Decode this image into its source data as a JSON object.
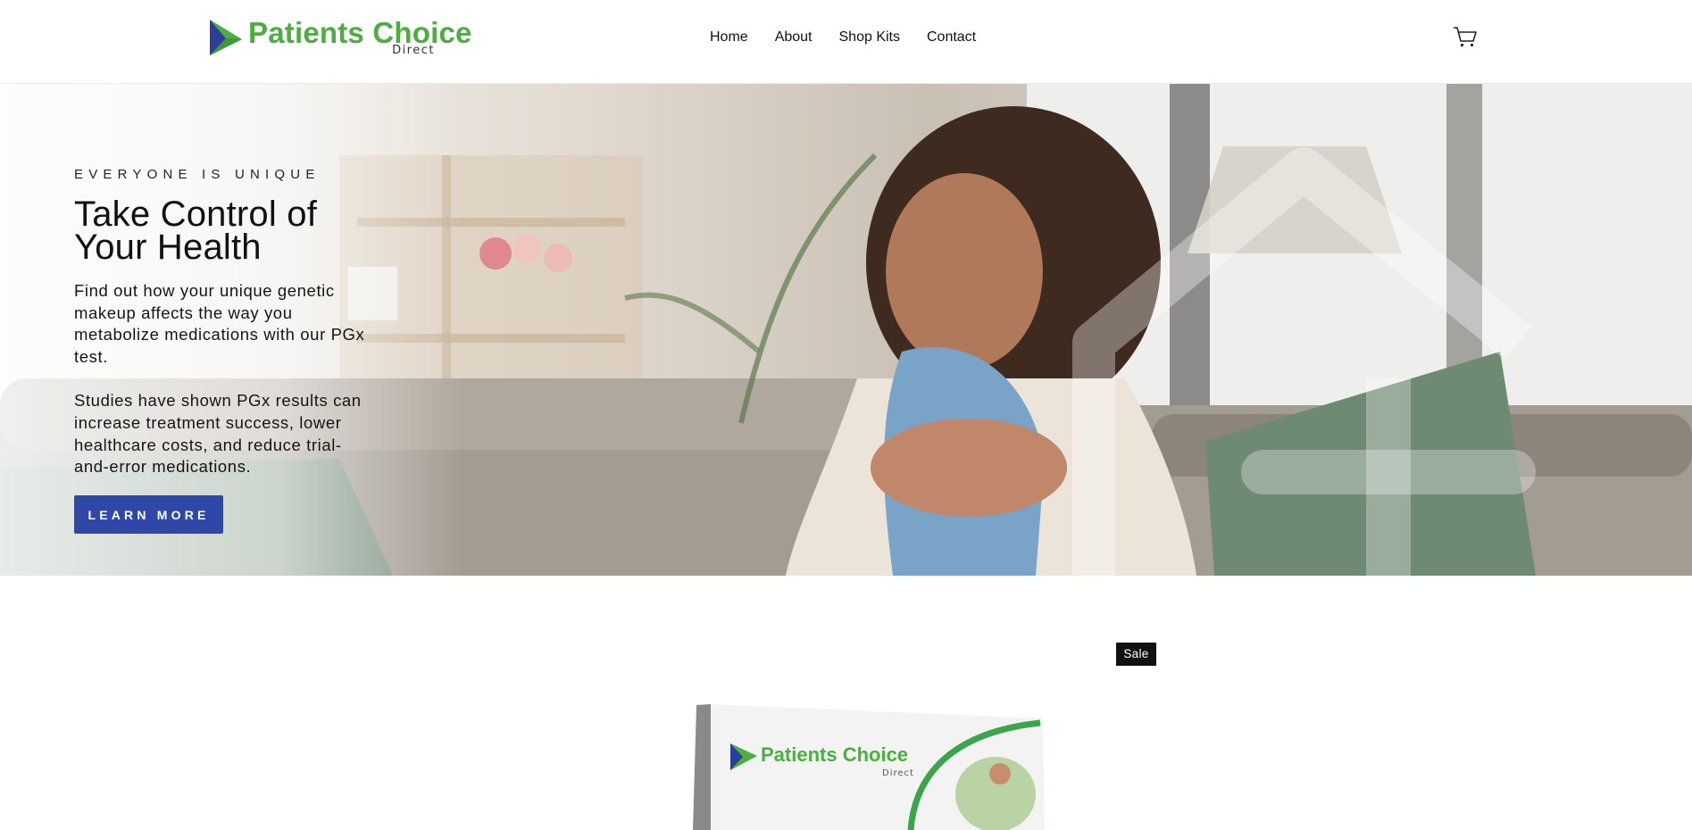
{
  "header": {
    "logo": {
      "name": "Patients Choice",
      "sub": "Direct"
    },
    "nav": [
      {
        "label": "Home"
      },
      {
        "label": "About"
      },
      {
        "label": "Shop Kits"
      },
      {
        "label": "Contact"
      }
    ],
    "cart_icon": "cart-icon"
  },
  "hero": {
    "eyebrow": "EVERYONE IS UNIQUE",
    "title_line1": "Take Control of",
    "title_line2": "Your Health",
    "paragraph1": "Find out how your unique genetic makeup affects the way you metabolize medications with our PGx test.",
    "paragraph2": "Studies have shown PGx results can increase treatment success, lower healthcare costs, and reduce trial-and-error medications.",
    "cta_label": "LEARN MORE"
  },
  "product": {
    "badge": "Sale",
    "box_brand": "Patients Choice",
    "box_sub": "Direct"
  },
  "colors": {
    "brand_green": "#4bae3f",
    "brand_blue": "#2f48a8",
    "badge_bg": "#111111"
  }
}
